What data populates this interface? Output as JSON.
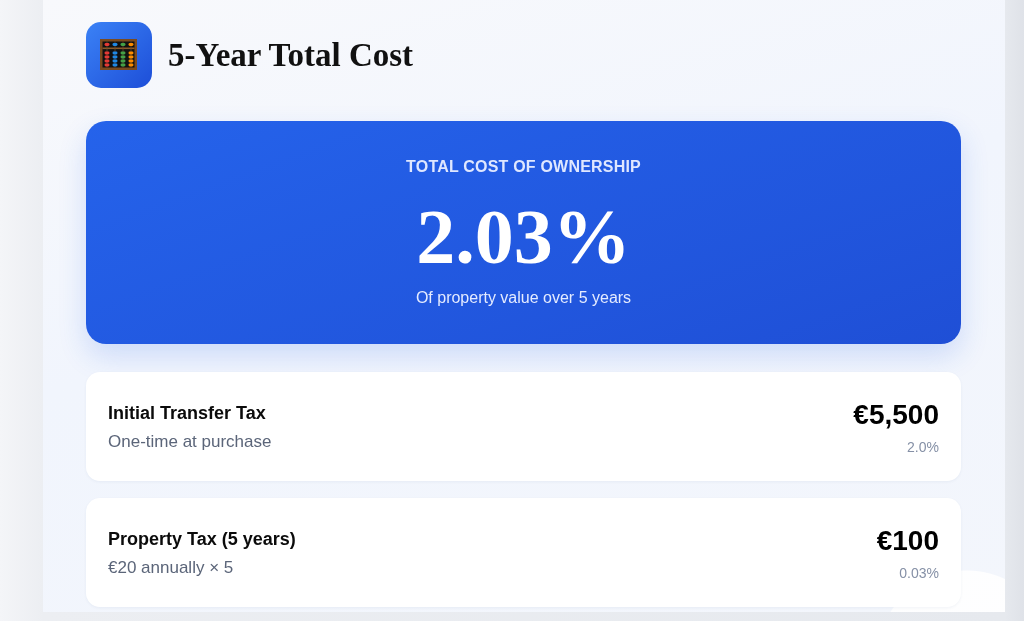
{
  "header": {
    "title": "5-Year Total Cost"
  },
  "summary": {
    "label": "TOTAL COST OF OWNERSHIP",
    "value": "2.03%",
    "caption": "Of property value over 5 years"
  },
  "costs": [
    {
      "title": "Initial Transfer Tax",
      "note": "One-time at purchase",
      "amount": "€5,500",
      "share": "2.0%"
    },
    {
      "title": "Property Tax (5 years)",
      "note": "€20 annually × 5",
      "amount": "€100",
      "share": "0.03%"
    }
  ]
}
